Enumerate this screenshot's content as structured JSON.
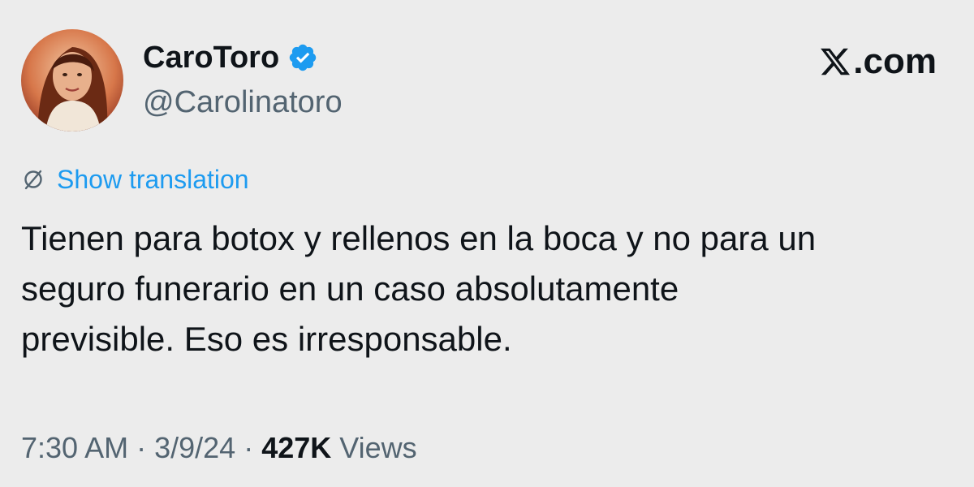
{
  "author": {
    "display_name": "CaroToro",
    "handle": "@Carolinatoro",
    "verified": true,
    "avatar_icon": "profile-photo"
  },
  "brand": {
    "logo_icon": "x-logo-icon",
    "text": ".com"
  },
  "translation": {
    "label": "Show translation",
    "icon": "globe-slash-icon"
  },
  "tweet": {
    "text": "Tienen para botox y rellenos en la boca y no para un\nseguro funerario en un caso absolutamente\nprevisible. Eso es irresponsable."
  },
  "meta": {
    "time": "7:30 AM",
    "separator": " · ",
    "date": "3/9/24",
    "views_count": "427K",
    "views_label": " Views"
  },
  "colors": {
    "background": "#ececec",
    "text": "#0f1419",
    "secondary": "#536471",
    "accent": "#1d9bf0"
  }
}
